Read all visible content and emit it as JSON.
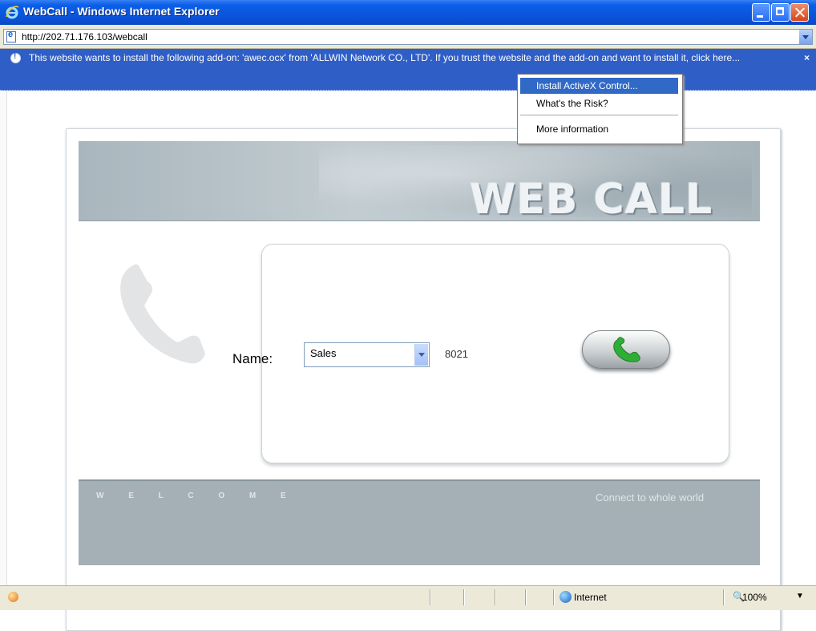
{
  "window": {
    "title": "WebCall - Windows Internet Explorer"
  },
  "address_bar": {
    "url": "http://202.71.176.103/webcall"
  },
  "info_bar": {
    "message": "This website wants to install the following add-on: 'awec.ocx' from 'ALLWIN Network CO., LTD'. If you trust the website and the add-on and want to install it, click here...",
    "close_label": "×"
  },
  "context_menu": {
    "items": [
      "Install ActiveX Control...",
      "What's the Risk?",
      "More information"
    ],
    "selected_index": 0
  },
  "page": {
    "banner_title": "WEB CALL",
    "name_label": "Name:",
    "name_select": {
      "selected": "Sales"
    },
    "extension": "8021",
    "footer_left": "W E L C O M E",
    "footer_right": "Connect to whole world"
  },
  "status_bar": {
    "zone": "Internet",
    "zoom": "100%"
  },
  "colors": {
    "title_bar": "#0a53d8",
    "info_bar": "#2f5ec6",
    "menu_highlight": "#3169c6",
    "call_icon": "#2fae37"
  }
}
